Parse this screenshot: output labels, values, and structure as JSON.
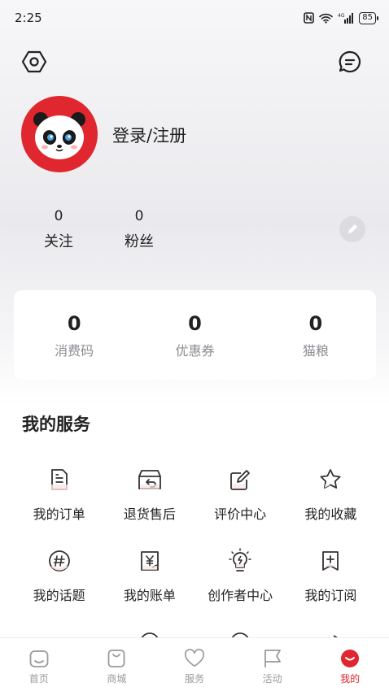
{
  "status_bar": {
    "time": "2:25",
    "battery": "85"
  },
  "profile": {
    "login_text": "登录/注册",
    "stats": [
      {
        "value": "0",
        "label": "关注"
      },
      {
        "value": "0",
        "label": "粉丝"
      }
    ]
  },
  "summary": [
    {
      "value": "0",
      "label": "消费码"
    },
    {
      "value": "0",
      "label": "优惠券"
    },
    {
      "value": "0",
      "label": "猫粮"
    }
  ],
  "services": {
    "title": "我的服务",
    "items": [
      {
        "label": "我的订单",
        "icon": "order-icon"
      },
      {
        "label": "退货售后",
        "icon": "return-box-icon"
      },
      {
        "label": "评价中心",
        "icon": "review-edit-icon"
      },
      {
        "label": "我的收藏",
        "icon": "star-icon"
      },
      {
        "label": "我的话题",
        "icon": "hashtag-icon"
      },
      {
        "label": "我的账单",
        "icon": "bill-icon"
      },
      {
        "label": "创作者中心",
        "icon": "lightbulb-icon"
      },
      {
        "label": "我的订阅",
        "icon": "subscribe-icon"
      }
    ]
  },
  "tabs": [
    {
      "label": "首页",
      "icon": "home-icon"
    },
    {
      "label": "商城",
      "icon": "shop-bag-icon"
    },
    {
      "label": "服务",
      "icon": "heart-icon"
    },
    {
      "label": "活动",
      "icon": "flag-icon"
    },
    {
      "label": "我的",
      "icon": "me-smile-icon",
      "active": true
    }
  ],
  "colors": {
    "brand_red": "#e0262e",
    "text_primary": "#222222",
    "text_secondary": "#8d8d93",
    "tab_inactive": "#9a9a9f"
  }
}
